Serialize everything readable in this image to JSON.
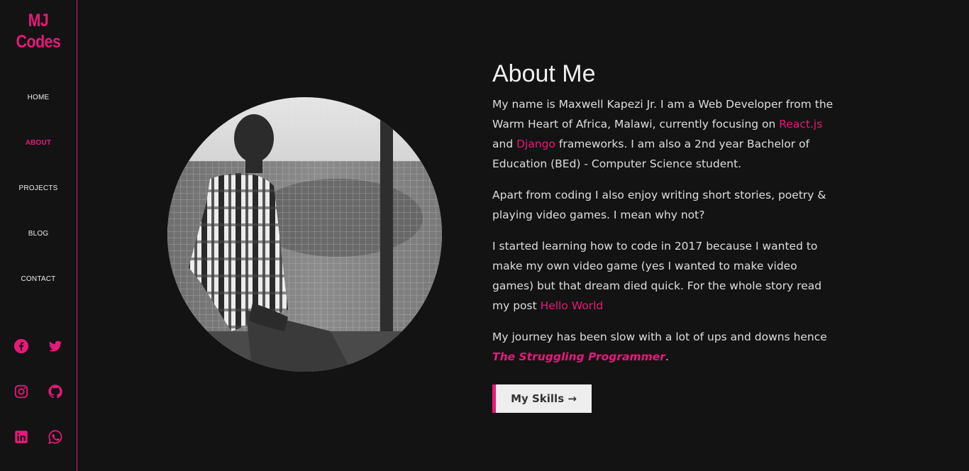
{
  "logo": {
    "line1": "MJ",
    "line2": "Codes"
  },
  "nav": {
    "home": "HOME",
    "about": "ABOUT",
    "projects": "PROJECTS",
    "blog": "BLOG",
    "contact": "CONTACT"
  },
  "social": [
    "facebook-icon",
    "twitter-icon",
    "instagram-icon",
    "github-icon",
    "linkedin-icon",
    "whatsapp-icon"
  ],
  "colors": {
    "accent": "#e8197a",
    "background": "#131313",
    "button_bg": "#eeeeee"
  },
  "about": {
    "title": "About Me",
    "p1_a": "My name is Maxwell Kapezi Jr. I am a Web Developer from the Warm Heart of Africa, Malawi, currently focusing on ",
    "p1_link1": "React.js",
    "p1_b": " and ",
    "p1_link2": "Django",
    "p1_c": " frameworks. I am also a 2nd year Bachelor of Education (BEd) - Computer Science student.",
    "p2": "Apart from coding I also enjoy writing short stories, poetry & playing video games. I mean why not?",
    "p3_a": "I started learning how to code in 2017 because I wanted to make my own video game (yes I wanted to make video games) but that dream died quick. For the whole story read my post ",
    "p3_link": "Hello World",
    "p4_a": "My journey has been slow with a lot of ups and downs hence ",
    "p4_em": "The Struggling Programmer",
    "p4_b": ".",
    "button": "My Skills →"
  }
}
